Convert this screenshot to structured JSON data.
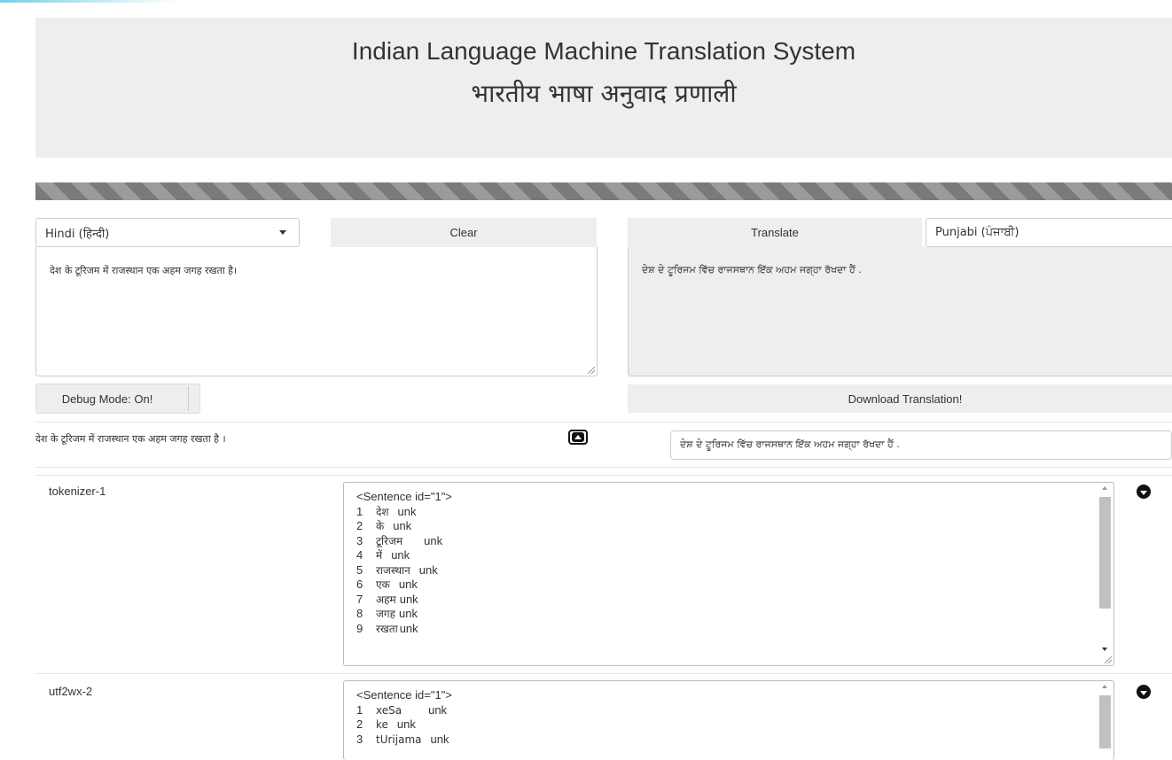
{
  "header": {
    "title_en": "Indian Language Machine Translation System",
    "title_hi": "भारतीय भाषा अनुवाद प्रणाली"
  },
  "controls": {
    "source_language": "Hindi (हिन्दी)",
    "clear_label": "Clear",
    "translate_label": "Translate",
    "target_language": "Punjabi (ਪੰਜਾਬੀ)",
    "debug_label": "Debug Mode: On!",
    "download_label": "Download Translation!"
  },
  "input": {
    "source_text": "देश के टूरिजम में राजस्थान एक अहम जगह रखता है।",
    "output_text": "ਦੇਸ਼ ਦੇ ਟੂਰਿਜਮ ਵਿੱਚ ਰਾਜਸਥਾਨ ਇੱਕ ਅਹਮ ਜਗ੍ਹਾ ਰੱਖਦਾ ਹੈਂ ."
  },
  "debug": {
    "sentence_source": "देश के टूरिजम में राजस्थान एक अहम जगह रखता है ।",
    "sentence_output": "ਦੇਸ਼ ਦੇ ਟੂਰਿਜਮ ਵਿੱਚ ਰਾਜਸਥਾਨ ਇੱਕ ਅਹਮ ਜਗ੍ਹਾ ਰੱਖਦਾ ਹੈਂ .",
    "modules": [
      {
        "name": "tokenizer-1",
        "header": "<Sentence id=\"1\">",
        "lines": [
          {
            "num": "1",
            "token": "देश",
            "tag": "unk"
          },
          {
            "num": "2",
            "token": "के",
            "tag": "unk"
          },
          {
            "num": "3",
            "token": "टूरिजम",
            "tag": "unk"
          },
          {
            "num": "4",
            "token": "में",
            "tag": "unk"
          },
          {
            "num": "5",
            "token": "राजस्थान",
            "tag": "unk"
          },
          {
            "num": "6",
            "token": "एक",
            "tag": "unk"
          },
          {
            "num": "7",
            "token": "अहम",
            "tag": "unk"
          },
          {
            "num": "8",
            "token": "जगह",
            "tag": "unk"
          },
          {
            "num": "9",
            "token": "रखता",
            "tag": "unk"
          }
        ]
      },
      {
        "name": "utf2wx-2",
        "header": "<Sentence id=\"1\">",
        "lines": [
          {
            "num": "1",
            "token": "xeSa",
            "tag": "unk"
          },
          {
            "num": "2",
            "token": "ke",
            "tag": "unk"
          },
          {
            "num": "3",
            "token": "tUrijama",
            "tag": "unk"
          }
        ]
      }
    ]
  }
}
